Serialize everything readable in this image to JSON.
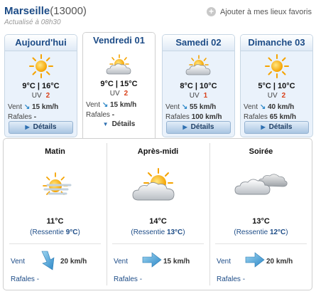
{
  "header": {
    "city": "Marseille",
    "postal_code": "(13000)",
    "updated": "Actualisé à 08h30",
    "favorite_label": "Ajouter à mes lieux favoris"
  },
  "days": [
    {
      "name": "Aujourd'hui",
      "icon": "sun-icon",
      "temp": "9°C | 16°C",
      "uv_label": "UV",
      "uv": "2",
      "wind_label": "Vent",
      "wind": "15 km/h",
      "gusts_label": "Rafales",
      "gusts": "-",
      "details": "Détails"
    },
    {
      "name": "Vendredi 01",
      "icon": "partly-cloudy-icon",
      "temp": "9°C | 15°C",
      "uv_label": "UV",
      "uv": "2",
      "wind_label": "Vent",
      "wind": "15 km/h",
      "gusts_label": "Rafales",
      "gusts": "-",
      "details": "Détails",
      "selected": true
    },
    {
      "name": "Samedi 02",
      "icon": "partly-cloudy-icon",
      "temp": "8°C | 10°C",
      "uv_label": "UV",
      "uv": "1",
      "wind_label": "Vent",
      "wind": "55 km/h",
      "gusts_label": "Rafales",
      "gusts": "100 km/h",
      "details": "Détails"
    },
    {
      "name": "Dimanche 03",
      "icon": "sun-icon",
      "temp": "5°C | 10°C",
      "uv_label": "UV",
      "uv": "2",
      "wind_label": "Vent",
      "wind": "40 km/h",
      "gusts_label": "Rafales",
      "gusts": "65 km/h",
      "details": "Détails"
    }
  ],
  "periods": [
    {
      "name": "Matin",
      "icon": "sun-haze-icon",
      "temp": "11°C",
      "feels_prefix": "(Ressentie ",
      "feels": "9°C",
      "feels_suffix": ")",
      "wind_label": "Vent",
      "wind": "20 km/h",
      "gusts_label": "Rafales",
      "gusts": "-"
    },
    {
      "name": "Après-midi",
      "icon": "partly-cloudy-icon",
      "temp": "14°C",
      "feels_prefix": "(Ressentie ",
      "feels": "13°C",
      "feels_suffix": ")",
      "wind_label": "Vent",
      "wind": "15 km/h",
      "gusts_label": "Rafales",
      "gusts": "-"
    },
    {
      "name": "Soirée",
      "icon": "clouds-icon",
      "temp": "13°C",
      "feels_prefix": "(Ressentie ",
      "feels": "12°C",
      "feels_suffix": ")",
      "wind_label": "Vent",
      "wind": "20 km/h",
      "gusts_label": "Rafales",
      "gusts": "-"
    }
  ],
  "colors": {
    "accent": "#1d4c87",
    "uv": "#d9411a",
    "wind_arrow": "#2d88c8"
  }
}
